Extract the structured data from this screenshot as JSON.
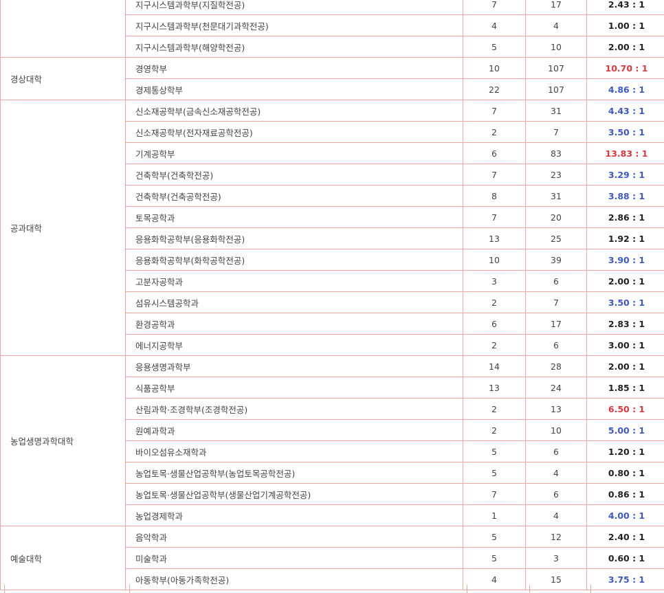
{
  "table": {
    "rows": [
      {
        "college": "",
        "dept": "지구시스템과학부(지질학전공)",
        "quota": "7",
        "applicants": "17",
        "ratio": "2.43 : 1",
        "ratio_color": "black"
      },
      {
        "college": "",
        "dept": "지구시스템과학부(천문대기과학전공)",
        "quota": "4",
        "applicants": "4",
        "ratio": "1.00 : 1",
        "ratio_color": "black"
      },
      {
        "college": "",
        "dept": "지구시스템과학부(해양학전공)",
        "quota": "5",
        "applicants": "10",
        "ratio": "2.00 : 1",
        "ratio_color": "black"
      },
      {
        "college": "경상대학",
        "dept": "경영학부",
        "quota": "10",
        "applicants": "107",
        "ratio": "10.70 : 1",
        "ratio_color": "red"
      },
      {
        "college": "",
        "dept": "경제통상학부",
        "quota": "22",
        "applicants": "107",
        "ratio": "4.86 : 1",
        "ratio_color": "blue"
      },
      {
        "college": "공과대학",
        "dept": "신소재공학부(금속신소재공학전공)",
        "quota": "7",
        "applicants": "31",
        "ratio": "4.43 : 1",
        "ratio_color": "blue"
      },
      {
        "college": "",
        "dept": "신소재공학부(전자재료공학전공)",
        "quota": "2",
        "applicants": "7",
        "ratio": "3.50 : 1",
        "ratio_color": "blue"
      },
      {
        "college": "",
        "dept": "기계공학부",
        "quota": "6",
        "applicants": "83",
        "ratio": "13.83 : 1",
        "ratio_color": "red"
      },
      {
        "college": "",
        "dept": "건축학부(건축학전공)",
        "quota": "7",
        "applicants": "23",
        "ratio": "3.29 : 1",
        "ratio_color": "blue"
      },
      {
        "college": "",
        "dept": "건축학부(건축공학전공)",
        "quota": "8",
        "applicants": "31",
        "ratio": "3.88 : 1",
        "ratio_color": "blue"
      },
      {
        "college": "",
        "dept": "토목공학과",
        "quota": "7",
        "applicants": "20",
        "ratio": "2.86 : 1",
        "ratio_color": "black"
      },
      {
        "college": "",
        "dept": "응용화학공학부(응용화학전공)",
        "quota": "13",
        "applicants": "25",
        "ratio": "1.92 : 1",
        "ratio_color": "black"
      },
      {
        "college": "",
        "dept": "응용화학공학부(화학공학전공)",
        "quota": "10",
        "applicants": "39",
        "ratio": "3.90 : 1",
        "ratio_color": "blue"
      },
      {
        "college": "",
        "dept": "고분자공학과",
        "quota": "3",
        "applicants": "6",
        "ratio": "2.00 : 1",
        "ratio_color": "black"
      },
      {
        "college": "",
        "dept": "섬유시스템공학과",
        "quota": "2",
        "applicants": "7",
        "ratio": "3.50 : 1",
        "ratio_color": "blue"
      },
      {
        "college": "",
        "dept": "환경공학과",
        "quota": "6",
        "applicants": "17",
        "ratio": "2.83 : 1",
        "ratio_color": "black"
      },
      {
        "college": "",
        "dept": "에너지공학부",
        "quota": "2",
        "applicants": "6",
        "ratio": "3.00 : 1",
        "ratio_color": "black"
      },
      {
        "college": "농업생명과학대학",
        "dept": "응용생명과학부",
        "quota": "14",
        "applicants": "28",
        "ratio": "2.00 : 1",
        "ratio_color": "black"
      },
      {
        "college": "",
        "dept": "식품공학부",
        "quota": "13",
        "applicants": "24",
        "ratio": "1.85 : 1",
        "ratio_color": "black"
      },
      {
        "college": "",
        "dept": "산림과학·조경학부(조경학전공)",
        "quota": "2",
        "applicants": "13",
        "ratio": "6.50 : 1",
        "ratio_color": "red"
      },
      {
        "college": "",
        "dept": "원예과학과",
        "quota": "2",
        "applicants": "10",
        "ratio": "5.00 : 1",
        "ratio_color": "blue"
      },
      {
        "college": "",
        "dept": "바이오섬유소재학과",
        "quota": "5",
        "applicants": "6",
        "ratio": "1.20 : 1",
        "ratio_color": "black"
      },
      {
        "college": "",
        "dept": "농업토목·생물산업공학부(농업토목공학전공)",
        "quota": "5",
        "applicants": "4",
        "ratio": "0.80 : 1",
        "ratio_color": "black"
      },
      {
        "college": "",
        "dept": "농업토목·생물산업공학부(생물산업기계공학전공)",
        "quota": "7",
        "applicants": "6",
        "ratio": "0.86 : 1",
        "ratio_color": "black"
      },
      {
        "college": "",
        "dept": "농업경제학과",
        "quota": "1",
        "applicants": "4",
        "ratio": "4.00 : 1",
        "ratio_color": "blue"
      },
      {
        "college": "예술대학",
        "dept": "음악학과",
        "quota": "5",
        "applicants": "12",
        "ratio": "2.40 : 1",
        "ratio_color": "black"
      },
      {
        "college": "",
        "dept": "미술학과",
        "quota": "5",
        "applicants": "3",
        "ratio": "0.60 : 1",
        "ratio_color": "black"
      },
      {
        "college": "",
        "dept": "아동학부(아동가족학전공)",
        "quota": "4",
        "applicants": "15",
        "ratio": "3.75 : 1",
        "ratio_color": "blue"
      }
    ]
  },
  "colors": {
    "border": "#f3a6a0",
    "ratio_black": "#222222",
    "ratio_blue": "#3a58c7",
    "ratio_red": "#e2353a"
  }
}
